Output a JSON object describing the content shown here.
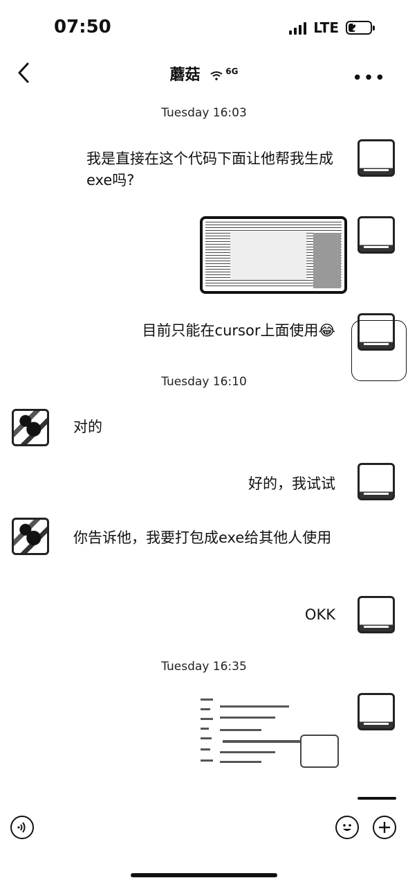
{
  "status_bar": {
    "time": "07:50",
    "network": "LTE",
    "battery": "29"
  },
  "header": {
    "title": "蘑菇",
    "network_badge": "6G",
    "back_icon": "chevron-left-icon",
    "more_icon": "more-icon"
  },
  "messages": {
    "t1": "Tuesday 16:03",
    "m1": "我是直接在这个代码下面让他帮我生成exe吗?",
    "m3": "目前只能在cursor上面使用😂",
    "t2": "Tuesday 16:10",
    "m4": "对的",
    "m5": "好的，我试试",
    "m6": "你告诉他，我要打包成exe给其他人使用",
    "m7": "OKK",
    "t3": "Tuesday 16:35"
  },
  "bottom": {
    "voice_icon": "voice-icon",
    "emoji_icon": "emoji-icon",
    "plus_icon": "plus-icon"
  }
}
